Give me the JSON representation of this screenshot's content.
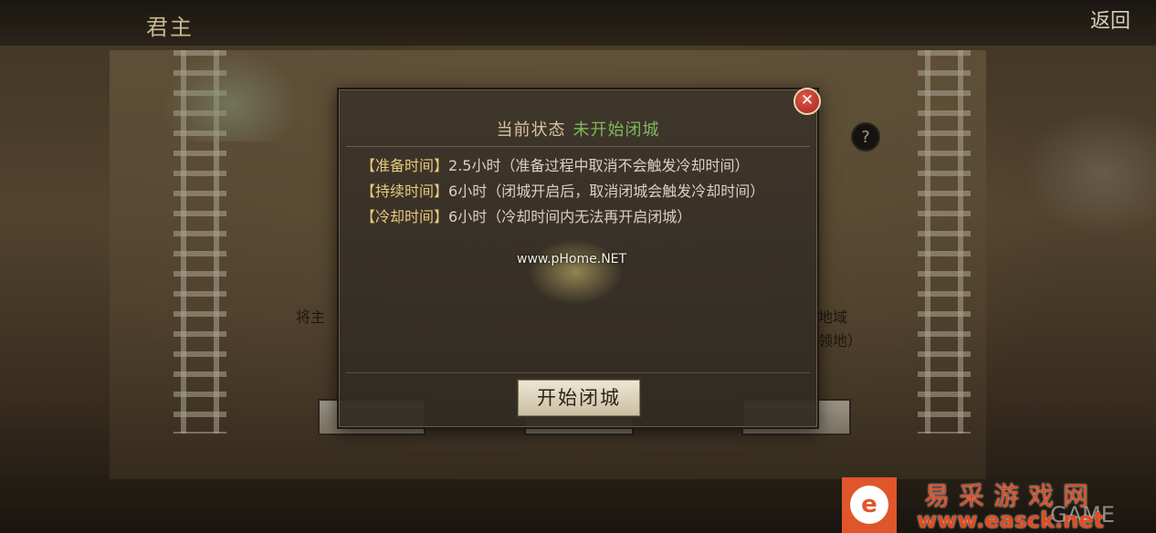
{
  "topbar": {
    "title": "君主",
    "back_label": "返回"
  },
  "help": {
    "icon": "question-icon",
    "glyph": "?"
  },
  "background": {
    "left_text": "将主",
    "right_text_1": "地域",
    "right_text_2": "领地）"
  },
  "dialog": {
    "state_label": "当前状态",
    "state_value": "未开始闭城",
    "close_glyph": "✕",
    "rules": [
      {
        "label": "【准备时间】",
        "text": "2.5小时（准备过程中取消不会触发冷却时间）"
      },
      {
        "label": "【持续时间】",
        "text": "6小时（闭城开启后，取消闭城会触发冷却时间）"
      },
      {
        "label": "【冷却时间】",
        "text": "6小时（冷却时间内无法再开启闭城）"
      }
    ],
    "start_button": "开始闭城"
  },
  "watermarks": {
    "center": "www.pHome.NET",
    "site_cn": "易采游戏网",
    "site_url": "www.easck.net",
    "site_mark": "e",
    "overlay_text": "GAME"
  },
  "colors": {
    "state_value": "#7fb85a",
    "rule_label": "#e7c97a",
    "close_button": "#c0392b",
    "brand_orange": "#e0562b"
  }
}
